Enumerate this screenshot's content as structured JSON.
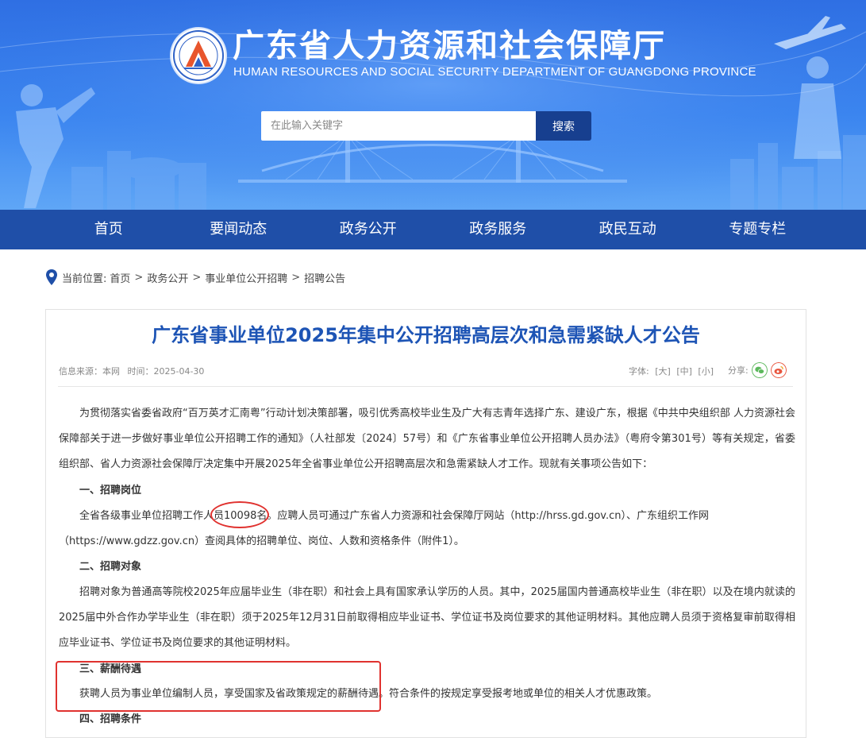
{
  "header": {
    "title": "广东省人力资源和社会保障厅",
    "subtitle": "HUMAN RESOURCES AND SOCIAL SECURITY DEPARTMENT OF GUANGDONG PROVINCE",
    "search_placeholder": "在此输入关键字",
    "search_button": "搜索"
  },
  "nav": {
    "items": [
      "首页",
      "要闻动态",
      "政务公开",
      "政务服务",
      "政民互动",
      "专题专栏"
    ]
  },
  "breadcrumb": {
    "label": "当前位置:",
    "items": [
      "首页",
      "政务公开",
      "事业单位公开招聘",
      "招聘公告"
    ],
    "separator": ">"
  },
  "article": {
    "title": "广东省事业单位2025年集中公开招聘高层次和急需紧缺人才公告",
    "source": "信息来源：本网",
    "time": "时间：2025-04-30",
    "fontsize_label": "字体:",
    "fontsize_options": [
      "[大]",
      "[中]",
      "[小]"
    ],
    "share_label": "分享:",
    "intro": "为贯彻落实省委省政府“百万英才汇南粤”行动计划决策部署，吸引优秀高校毕业生及广大有志青年选择广东、建设广东，根据《中共中央组织部 人力资源社会保障部关于进一步做好事业单位公开招聘工作的通知》（人社部发〔2024〕57号）和《广东省事业单位公开招聘人员办法》（粤府令第301号）等有关规定，省委组织部、省人力资源社会保障厅决定集中开展2025年全省事业单位公开招聘高层次和急需紧缺人才工作。现就有关事项公告如下：",
    "sections": [
      {
        "heading": "一、招聘岗位",
        "lines": [
          "全省各级事业单位招聘工作人员10098名。应聘人员可通过广东省人力资源和社会保障厅网站（http://hrss.gd.gov.cn）、广东组织工作网",
          "（https://www.gdzz.gov.cn）查阅具体的招聘单位、岗位、人数和资格条件（附件1）。"
        ]
      },
      {
        "heading": "二、招聘对象",
        "body": "招聘对象为普通高等院校2025年应届毕业生（非在职）和社会上具有国家承认学历的人员。其中，2025届国内普通高校毕业生（非在职）以及在境内就读的2025届中外合作办学毕业生（非在职）须于2025年12月31日前取得相应毕业证书、学位证书及岗位要求的其他证明材料。其他应聘人员须于资格复审前取得相应毕业证书、学位证书及岗位要求的其他证明材料。"
      },
      {
        "heading": "三、薪酬待遇",
        "lines": [
          "获聘人员为事业单位编制人员，享受国家及省政策规定的薪酬待遇。符合条件的按规定享受报考地或单位的相关人才优惠政策。"
        ]
      },
      {
        "heading": "四、招聘条件"
      }
    ]
  },
  "colors": {
    "nav_bg": "#1f4fa8",
    "title_blue": "#1d54b5",
    "search_btn": "#173f8f",
    "highlight_red": "#e0322f",
    "wechat_green": "#5cb85c",
    "weibo_red": "#e8553e"
  }
}
